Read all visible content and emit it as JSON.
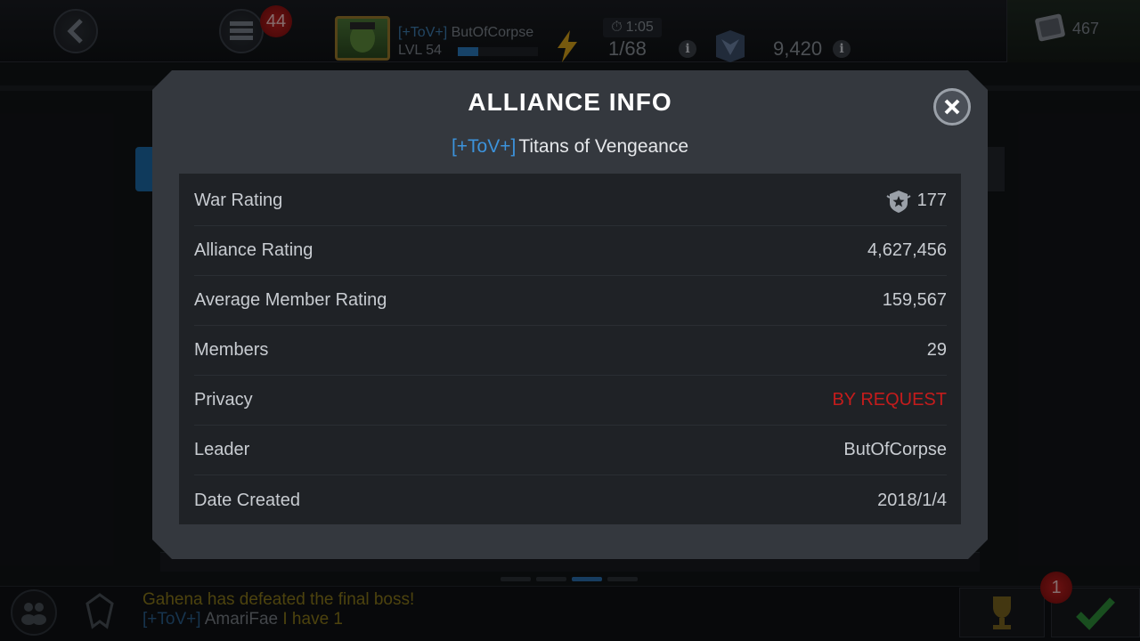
{
  "topbar": {
    "notification_count": "44",
    "player": {
      "tag": "[+ToV+]",
      "name": "ButOfCorpse",
      "level": "LVL 54",
      "xp_progress": 0.25
    },
    "timer": "1:05",
    "energy": "1/68",
    "shards": "9,420",
    "gold": "467"
  },
  "modal": {
    "title": "ALLIANCE INFO",
    "alliance_tag": "[+ToV+]",
    "alliance_name": "Titans of Vengeance",
    "rows": [
      {
        "label": "War Rating",
        "value": "177"
      },
      {
        "label": "Alliance Rating",
        "value": "4,627,456"
      },
      {
        "label": "Average Member Rating",
        "value": "159,567"
      },
      {
        "label": "Members",
        "value": "29"
      },
      {
        "label": "Privacy",
        "value": "BY REQUEST"
      },
      {
        "label": "Leader",
        "value": "ButOfCorpse"
      },
      {
        "label": "Date Created",
        "value": "2018/1/4"
      }
    ]
  },
  "feed": {
    "line1": "Gahena has defeated the final boss!",
    "line2_tag": "[+ToV+]",
    "line2_name": "AmariFae",
    "line2_message": "I have 1"
  },
  "bottombar": {
    "notification_count": "1"
  },
  "colors": {
    "accent_blue": "#3c93dc",
    "privacy_red": "#c51c1c",
    "modal_bg": "#34383e",
    "table_bg": "#1f2226"
  }
}
